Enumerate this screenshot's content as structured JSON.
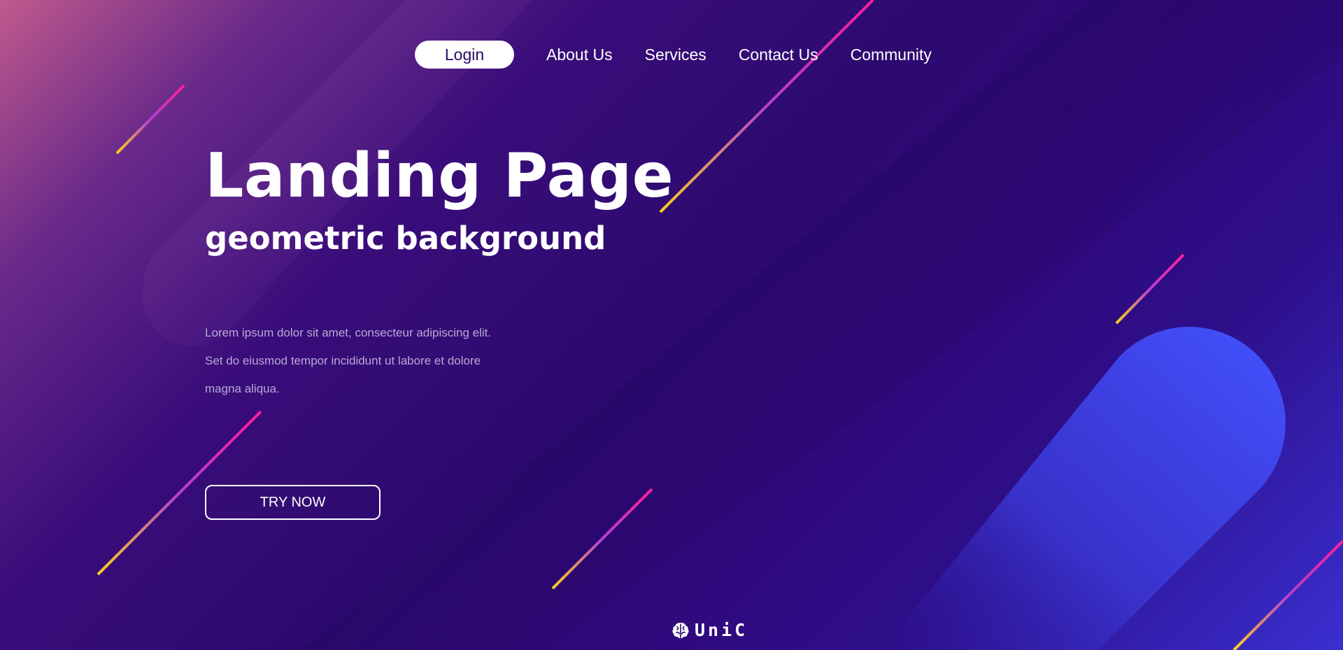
{
  "nav": {
    "login_label": "Login",
    "items": [
      {
        "label": "About Us"
      },
      {
        "label": "Services"
      },
      {
        "label": "Contact Us"
      },
      {
        "label": "Community"
      }
    ]
  },
  "hero": {
    "title": "Landing Page",
    "subtitle": "geometric background",
    "body_lines": [
      "Lorem ipsum dolor sit amet, consecteur adipiscing elit.",
      "Set do eiusmod tempor incididunt ut labore et dolore",
      "magna aliqua."
    ],
    "cta_label": "TRY NOW"
  },
  "footer": {
    "logo_text": "UniC",
    "logo_icon": "brain-icon"
  },
  "colors": {
    "accent_pink": "#ff2d9a",
    "accent_yellow": "#ffd21a",
    "accent_blue": "#3f4ff0",
    "background_deep": "#2c0a6f"
  }
}
